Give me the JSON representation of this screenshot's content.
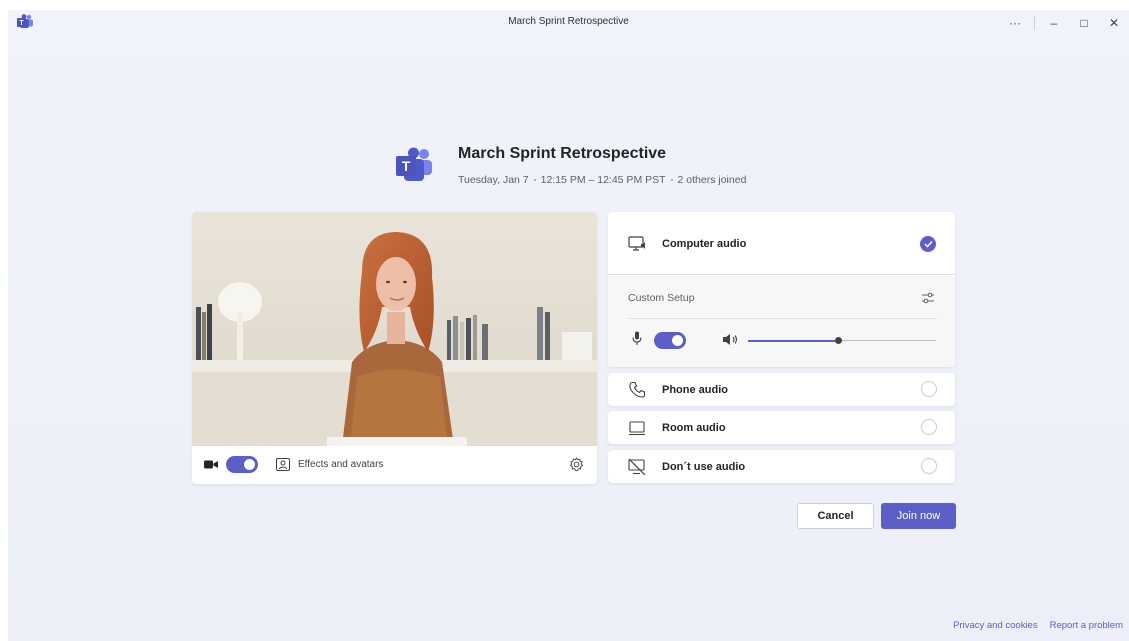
{
  "window": {
    "title": "March Sprint Retrospective",
    "controls": {
      "more": "···",
      "minimize": "–",
      "maximize": "□",
      "close": "✕"
    }
  },
  "meeting": {
    "title": "March Sprint Retrospective",
    "date": "Tuesday, Jan 7",
    "time": "12:15 PM – 12:45 PM PST",
    "participants": "2 others joined"
  },
  "video": {
    "camera_on": true,
    "effects_label": "Effects and avatars"
  },
  "audio": {
    "options": [
      {
        "label": "Computer audio",
        "icon": "computer-audio-icon",
        "selected": true
      },
      {
        "label": "Phone audio",
        "icon": "phone-icon",
        "selected": false
      },
      {
        "label": "Room audio",
        "icon": "room-audio-icon",
        "selected": false
      },
      {
        "label": "Don´t use audio",
        "icon": "no-audio-icon",
        "selected": false
      }
    ],
    "custom_setup_label": "Custom Setup",
    "mic_on": true,
    "speaker_volume": 0.48
  },
  "buttons": {
    "cancel": "Cancel",
    "join": "Join now"
  },
  "footer": {
    "privacy": "Privacy and cookies",
    "report": "Report a problem"
  },
  "colors": {
    "accent": "#5b5fc7",
    "background": "#f1f3fb"
  }
}
